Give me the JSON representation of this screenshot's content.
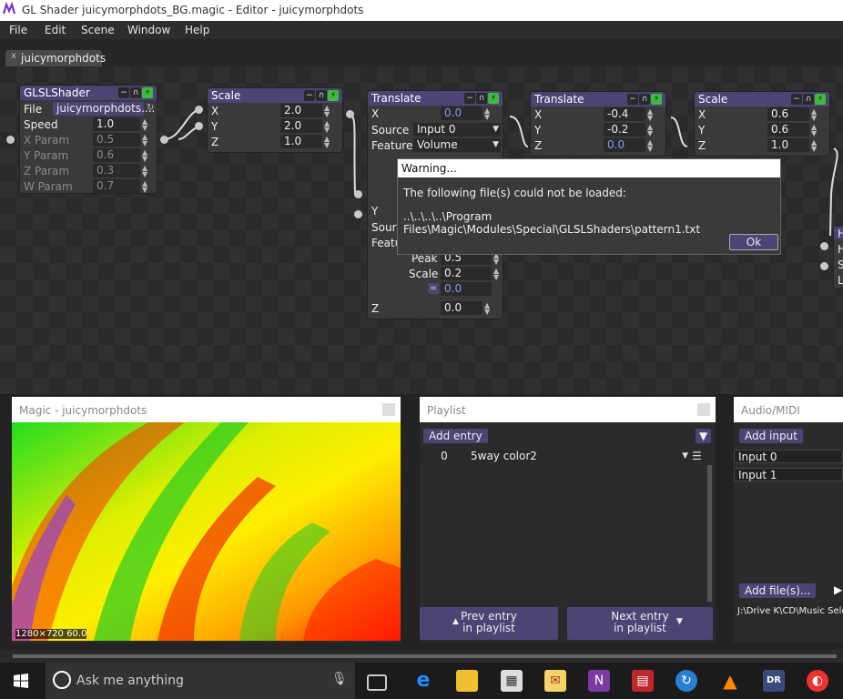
{
  "window": {
    "title": "GL Shader juicymorphdots_BG.magic - Editor - juicymorphdots"
  },
  "menu": [
    "File",
    "Edit",
    "Scene",
    "Window",
    "Help"
  ],
  "tab": {
    "label": "juicymorphdots",
    "close": "x"
  },
  "nodes": {
    "glsl": {
      "title": "GLSLShader",
      "file_label": "File",
      "file_value": "juicymorphdots....",
      "params": [
        {
          "label": "Speed",
          "value": "1.0"
        },
        {
          "label": "X Param",
          "value": "0.5"
        },
        {
          "label": "Y Param",
          "value": "0.6"
        },
        {
          "label": "Z Param",
          "value": "0.3"
        },
        {
          "label": "W Param",
          "value": "0.7"
        }
      ]
    },
    "scale1": {
      "title": "Scale",
      "rows": [
        {
          "label": "X",
          "value": "2.0"
        },
        {
          "label": "Y",
          "value": "2.0"
        },
        {
          "label": "Z",
          "value": "1.0"
        }
      ]
    },
    "translate1": {
      "title": "Translate",
      "x_label": "X",
      "x_value": "0.0",
      "source_label": "Source",
      "source_value": "Input 0",
      "feature_label": "Feature",
      "feature_value": "Volume",
      "y_label": "Y",
      "source2_label": "Sour",
      "feature2_label": "Featu",
      "peak_label": "Peak",
      "peak_value": "0.5",
      "scale_label": "Scale",
      "scale_value": "0.2",
      "eq_value": "0.0",
      "z_label": "Z",
      "z_value": "0.0"
    },
    "translate2": {
      "title": "Translate",
      "rows": [
        {
          "label": "X",
          "value": "-0.4"
        },
        {
          "label": "Y",
          "value": "-0.2"
        },
        {
          "label": "Z",
          "value": "0.0"
        }
      ]
    },
    "scale2": {
      "title": "Scale",
      "rows": [
        {
          "label": "X",
          "value": "0.6"
        },
        {
          "label": "Y",
          "value": "0.6"
        },
        {
          "label": "Z",
          "value": "1.0"
        }
      ]
    },
    "partial": {
      "letters": [
        "H",
        "H",
        "S",
        "L"
      ]
    }
  },
  "dialog": {
    "title": "Warning...",
    "message": "The following file(s) could not be loaded:",
    "path": "..\\..\\..\\..\\Program Files\\Magic\\Modules\\Special\\GLSLShaders\\pattern1.txt",
    "ok": "Ok"
  },
  "preview": {
    "title": "Magic - juicymorphdots",
    "status": "1280×720  60.0"
  },
  "playlist": {
    "title": "Playlist",
    "add": "Add entry",
    "entry_index": "0",
    "entry_name": "5way color2",
    "prev": "Prev entry\nin playlist",
    "next": "Next entry\nin playlist"
  },
  "audio": {
    "title": "Audio/MIDI",
    "add": "Add input",
    "inputs": [
      "Input 0",
      "Input 1"
    ],
    "add_files": "Add file(s)...",
    "path": "J:\\Drive K\\CD\\Music Selection"
  },
  "taskbar": {
    "search_placeholder": "Ask me anything",
    "icons": [
      "windows-start-icon",
      "task-view-icon",
      "edge-icon",
      "file-explorer-icon",
      "store-icon",
      "mail-icon",
      "onenote-icon",
      "reader-icon",
      "sync-icon",
      "vlc-icon",
      "dynamic-range-icon",
      "app-icon"
    ]
  }
}
